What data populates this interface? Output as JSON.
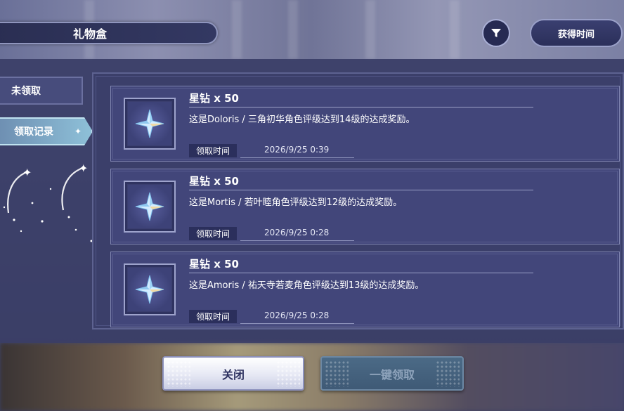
{
  "header": {
    "title": "礼物盒",
    "filter_icon": "filter-funnel-icon",
    "sort_label": "获得时间"
  },
  "tabs": [
    {
      "label": "未领取",
      "active": false
    },
    {
      "label": "领取记录",
      "active": true
    }
  ],
  "rewards": [
    {
      "title": "星钻 x 50",
      "description": "这是Doloris / 三角初华角色评级达到14级的达成奖励。",
      "time_label": "领取时间",
      "time": "2026/9/25 0:39",
      "icon": "star-diamond-icon"
    },
    {
      "title": "星钻 x 50",
      "description": "这是Mortis / 若叶睦角色评级达到12级的达成奖励。",
      "time_label": "领取时间",
      "time": "2026/9/25 0:28",
      "icon": "star-diamond-icon"
    },
    {
      "title": "星钻 x 50",
      "description": "这是Amoris / 祐天寺若麦角色评级达到13级的达成奖励。",
      "time_label": "领取时间",
      "time": "2026/9/25 0:28",
      "icon": "star-diamond-icon"
    }
  ],
  "buttons": {
    "close_label": "关闭",
    "claim_all_label": "一键领取",
    "claim_all_enabled": false
  },
  "colors": {
    "panel": "#3a3e66",
    "accent_tab": "#8ec0d8",
    "card": "#42467a"
  }
}
